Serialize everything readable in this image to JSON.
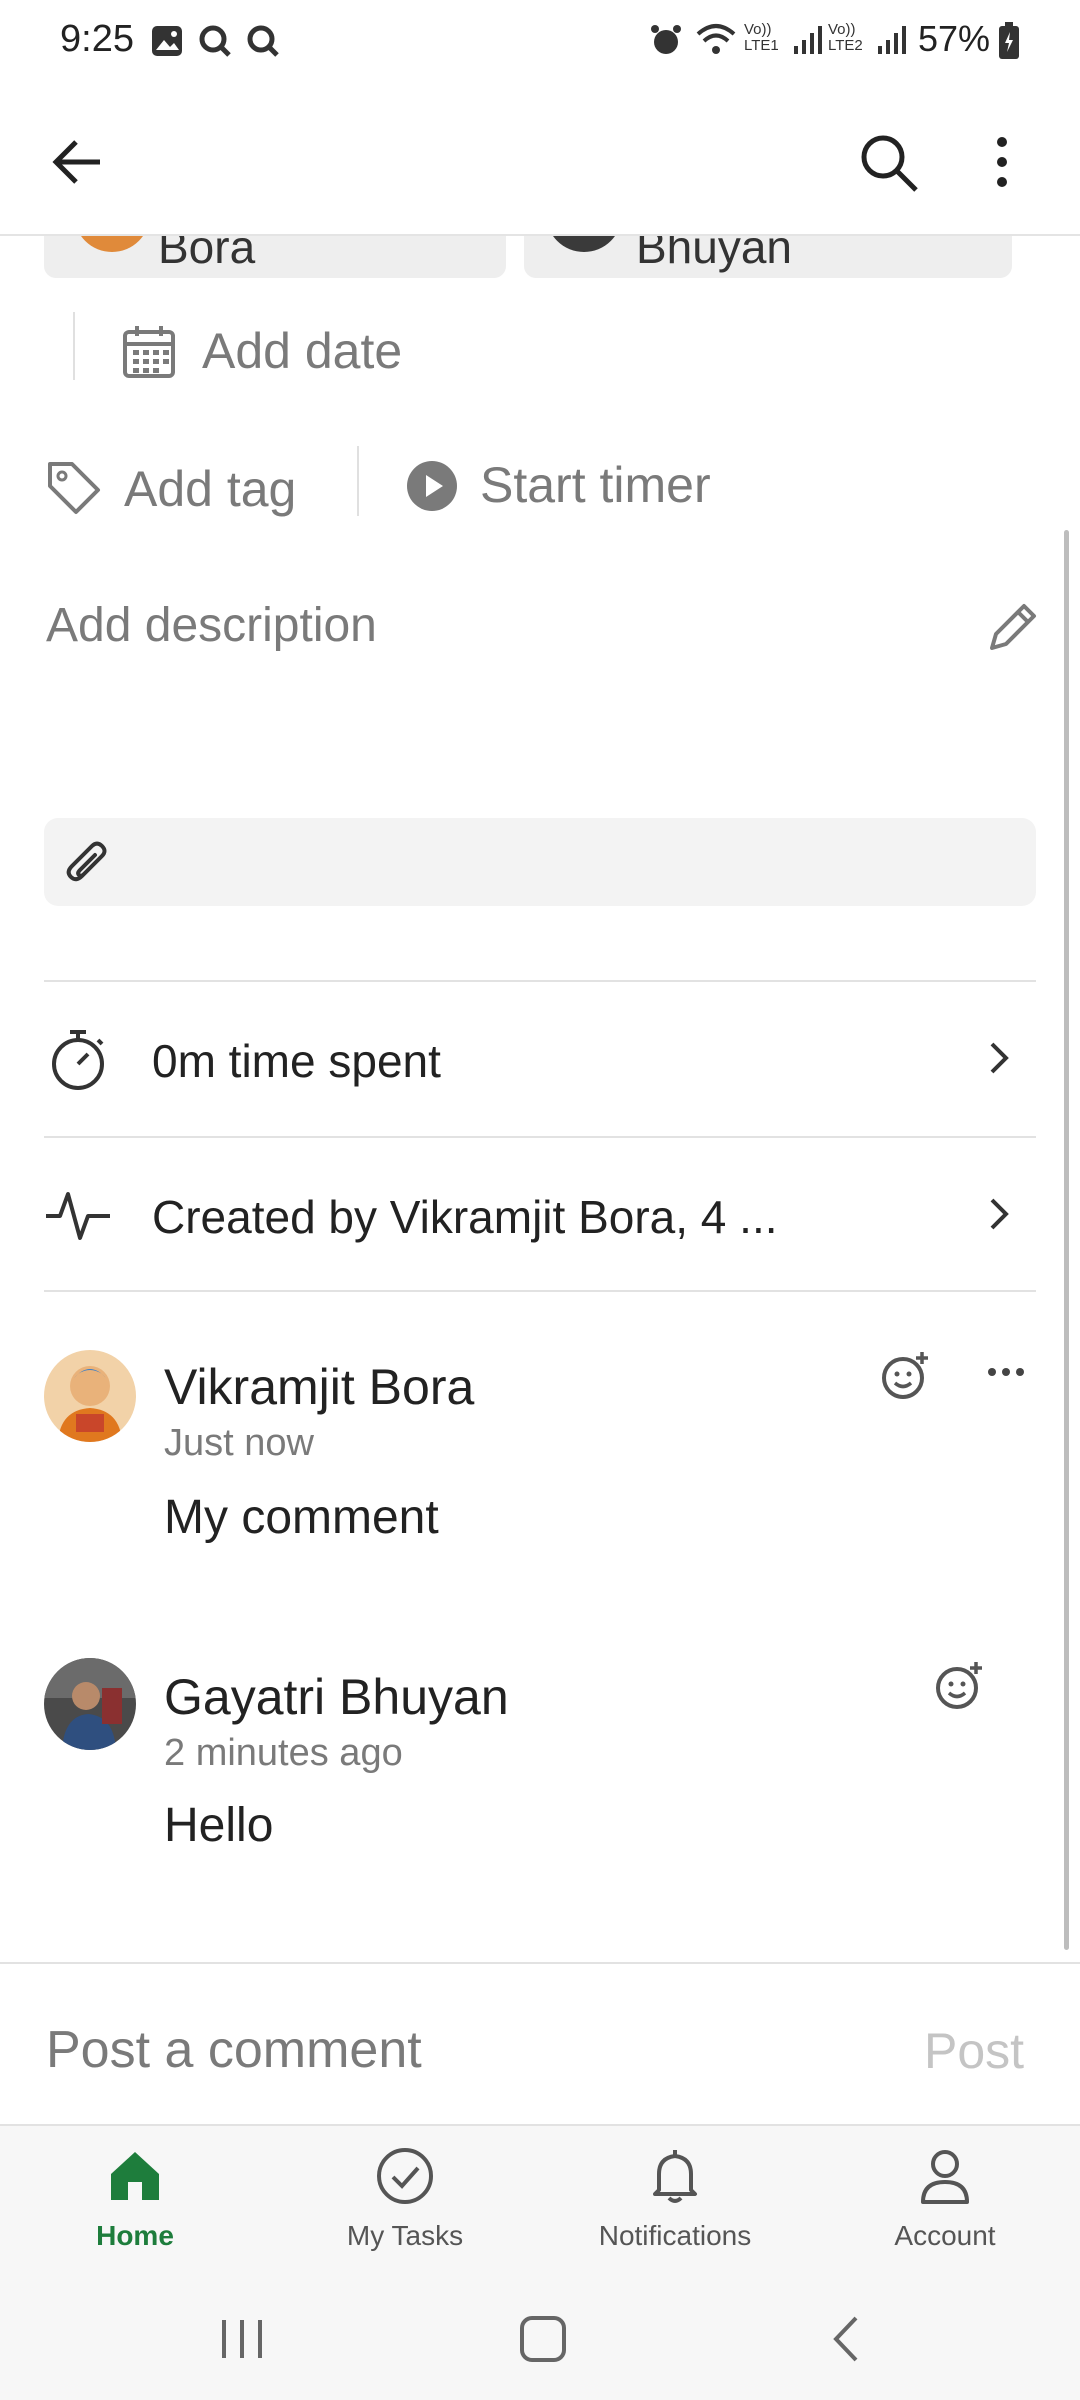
{
  "status_bar": {
    "time": "9:25",
    "battery": "57%",
    "network_labels": [
      "Vo)) LTE1",
      "Vo)) LTE2"
    ]
  },
  "app_bar": {
    "back_icon": "arrow-left-icon",
    "search_icon": "search-icon",
    "more_icon": "more-vertical-icon"
  },
  "assignees": [
    {
      "name": "Bora"
    },
    {
      "name": "Bhuyan"
    }
  ],
  "date": {
    "label": "Add date",
    "icon": "calendar-icon"
  },
  "actions": {
    "tag_label": "Add tag",
    "timer_label": "Start timer"
  },
  "description": {
    "placeholder": "Add description",
    "edit_icon": "pencil-icon"
  },
  "attachment": {
    "icon": "paperclip-icon"
  },
  "time_spent": {
    "label": "0m time spent"
  },
  "activity": {
    "label": "Created by Vikramjit Bora, 4 ..."
  },
  "comments": [
    {
      "author": "Vikramjit Bora",
      "time": "Just now",
      "text": "My comment"
    },
    {
      "author": "Gayatri Bhuyan",
      "time": "2 minutes ago",
      "text": "Hello"
    }
  ],
  "composer": {
    "placeholder": "Post a comment",
    "post_label": "Post"
  },
  "bottom_nav": [
    {
      "label": "Home",
      "icon": "home-icon",
      "active": true
    },
    {
      "label": "My Tasks",
      "icon": "check-circle-icon",
      "active": false
    },
    {
      "label": "Notifications",
      "icon": "bell-icon",
      "active": false
    },
    {
      "label": "Account",
      "icon": "person-icon",
      "active": false
    }
  ],
  "colors": {
    "accent": "#1e7d3c",
    "text": "#222222",
    "muted": "#7a7a7a"
  }
}
